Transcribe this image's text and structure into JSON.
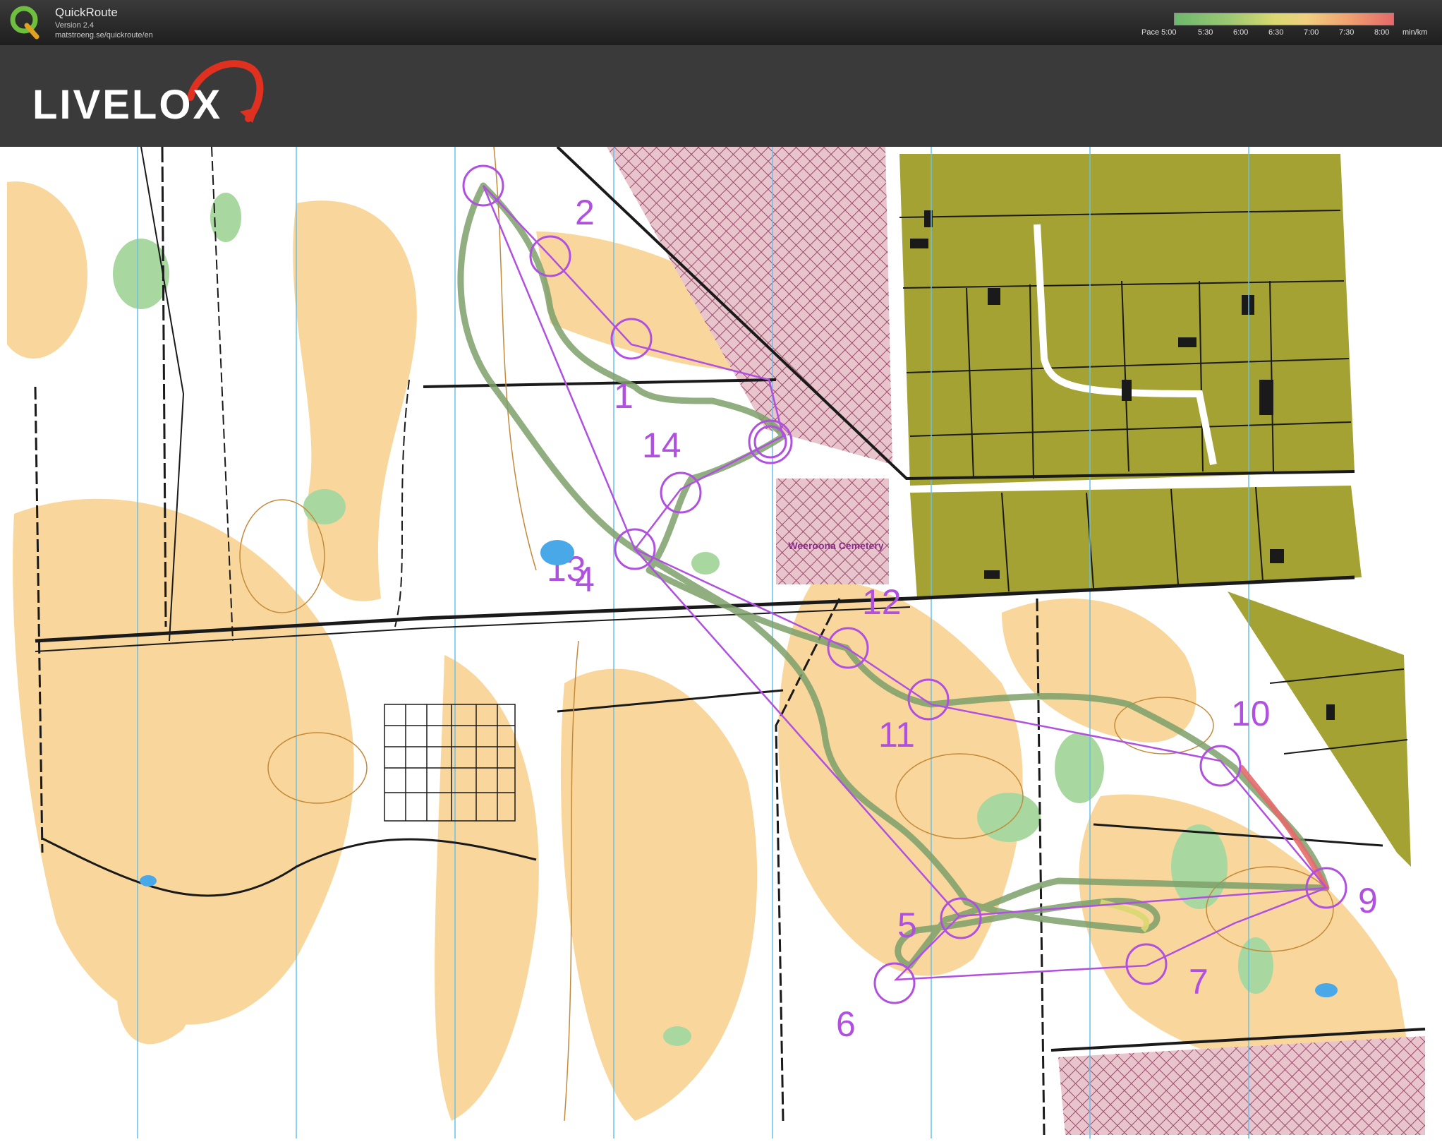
{
  "app": {
    "name": "QuickRoute",
    "version": "Version 2.4",
    "url": "matstroeng.se/quickroute/en"
  },
  "pace_legend": {
    "label": "Pace 5:00",
    "ticks": [
      "5:30",
      "6:00",
      "6:30",
      "7:00",
      "7:30",
      "8:00"
    ],
    "unit": "min/km",
    "colors": [
      "#6db86d",
      "#9cc873",
      "#d8d870",
      "#f0d080",
      "#f0a070",
      "#e46a6a"
    ]
  },
  "brand": {
    "name": "LIVELOX",
    "accent": "#e03020"
  },
  "map": {
    "feature_label": "Weeroona Cemetery",
    "course_color": "#b050e0",
    "controls": [
      {
        "label": "1"
      },
      {
        "label": "2"
      },
      {
        "label": "4"
      },
      {
        "label": "5"
      },
      {
        "label": "6"
      },
      {
        "label": "7"
      },
      {
        "label": "9"
      },
      {
        "label": "10"
      },
      {
        "label": "11"
      },
      {
        "label": "12"
      },
      {
        "label": "13"
      },
      {
        "label": "14"
      }
    ],
    "colors": {
      "open_land": "#f9d79c",
      "forest": "#ffffff",
      "green": "#a8d8a0",
      "private": "#a3a233",
      "out_of_bounds": "#d9a3b3",
      "route": "#7da06a"
    }
  }
}
